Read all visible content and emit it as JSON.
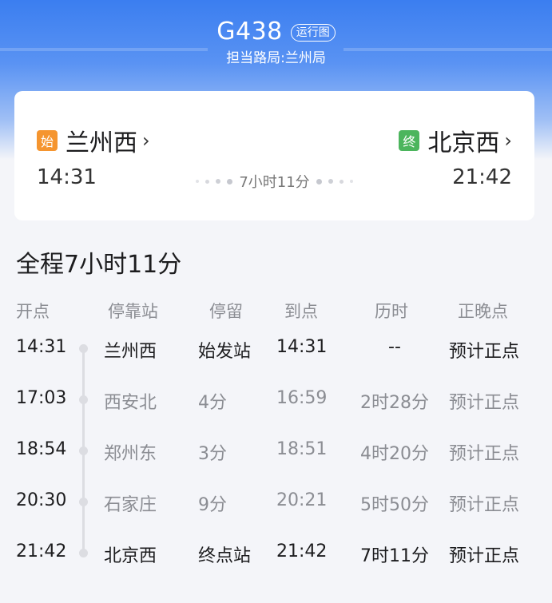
{
  "header": {
    "train_code": "G438",
    "schedule_link": "运行图",
    "bureau": "担当路局:兰州局"
  },
  "card": {
    "from": {
      "tag": "始",
      "name": "兰州西",
      "time": "14:31"
    },
    "to": {
      "tag": "终",
      "name": "北京西",
      "time": "21:42"
    },
    "duration": "7小时11分"
  },
  "total": {
    "title": "全程7小时11分"
  },
  "table": {
    "headers": [
      "开点",
      "停靠站",
      "停留",
      "到点",
      "历时",
      "正晚点"
    ],
    "rows": [
      {
        "depart": "14:31",
        "station": "兰州西",
        "stay": "始发站",
        "arrive": "14:31",
        "elapsed": "--",
        "status": "预计正点",
        "highlight": true
      },
      {
        "depart": "17:03",
        "station": "西安北",
        "stay": "4分",
        "arrive": "16:59",
        "elapsed": "2时28分",
        "status": "预计正点",
        "highlight": false
      },
      {
        "depart": "18:54",
        "station": "郑州东",
        "stay": "3分",
        "arrive": "18:51",
        "elapsed": "4时20分",
        "status": "预计正点",
        "highlight": false
      },
      {
        "depart": "20:30",
        "station": "石家庄",
        "stay": "9分",
        "arrive": "20:21",
        "elapsed": "5时50分",
        "status": "预计正点",
        "highlight": false
      },
      {
        "depart": "21:42",
        "station": "北京西",
        "stay": "终点站",
        "arrive": "21:42",
        "elapsed": "7时11分",
        "status": "预计正点",
        "highlight": true
      }
    ]
  },
  "icons": {
    "chevron": "chevron-right-icon"
  },
  "colors": {
    "start_tag": "#f5952f",
    "end_tag": "#4cb55d",
    "header_blue": "#3b7ef0"
  }
}
